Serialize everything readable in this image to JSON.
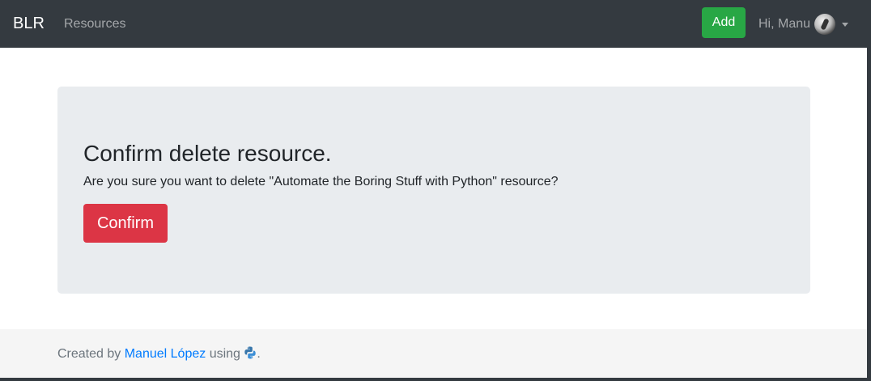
{
  "navbar": {
    "brand": "BLR",
    "links": [
      {
        "label": "Resources"
      }
    ],
    "add_button": "Add",
    "user_greeting": "Hi, Manu"
  },
  "jumbotron": {
    "title": "Confirm delete resource.",
    "message": "Are you sure you want to delete \"Automate the Boring Stuff with Python\" resource?",
    "confirm_button": "Confirm"
  },
  "footer": {
    "prefix": "Created by",
    "author_link": "Manuel López",
    "middle": "using",
    "suffix": ".",
    "icon": "python-icon"
  },
  "colors": {
    "navbar_bg": "#343a40",
    "add_button": "#28a745",
    "danger": "#dc3545",
    "jumbotron_bg": "#e9ecef",
    "link": "#007bff",
    "footer_bg": "#f5f5f5"
  }
}
